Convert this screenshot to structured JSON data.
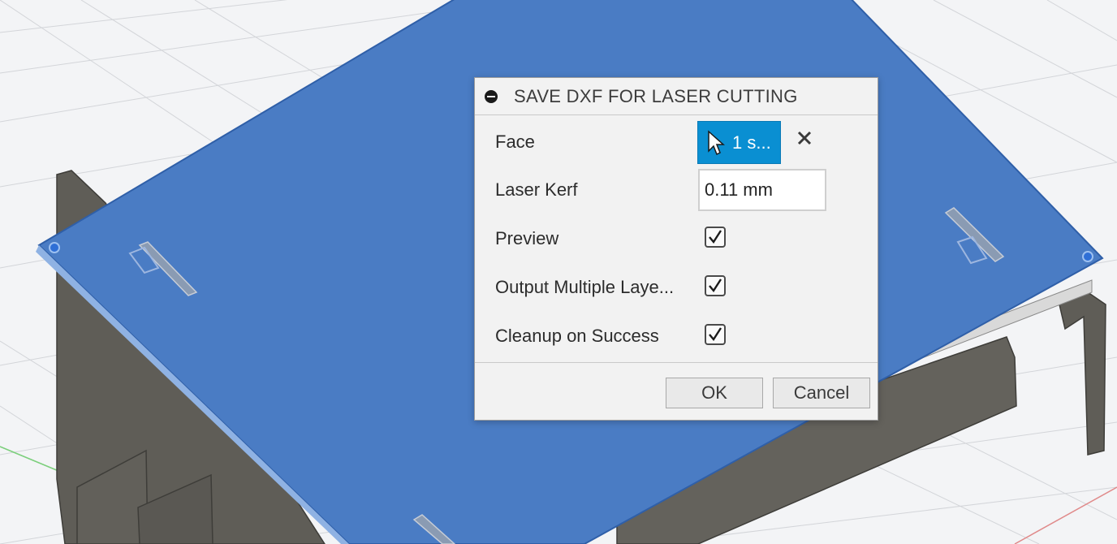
{
  "dialog": {
    "title": "SAVE DXF FOR LASER CUTTING",
    "face": {
      "label": "Face",
      "selection": "1 s..."
    },
    "kerf": {
      "label": "Laser Kerf",
      "value": "0.11 mm"
    },
    "preview": {
      "label": "Preview",
      "checked": true
    },
    "multiple_layers": {
      "label": "Output Multiple Laye...",
      "checked": true
    },
    "cleanup": {
      "label": "Cleanup on Success",
      "checked": true
    },
    "ok_label": "OK",
    "cancel_label": "Cancel"
  },
  "colors": {
    "panel_blue": "#4a7cc4",
    "selection_blue": "#0a8fd2",
    "part_gray": "#5e5c56",
    "dialog_bg": "#f2f2f2"
  },
  "icons": [
    "collapse-icon",
    "cursor-icon",
    "close-icon",
    "checkmark-icon"
  ]
}
